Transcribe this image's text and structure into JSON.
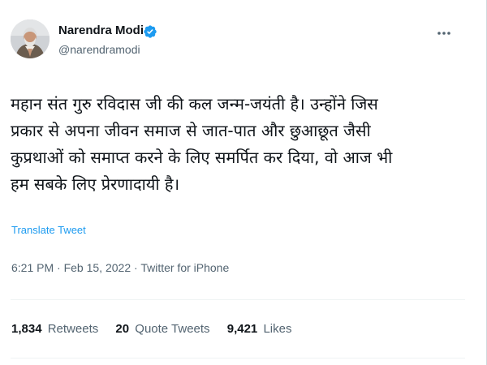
{
  "author": {
    "name": "Narendra Modi",
    "handle": "@narendramodi",
    "verified": true
  },
  "tweet": {
    "lines": [
      "महान संत गुरु रविदास जी की कल जन्म-जयंती है। उन्होंने जिस",
      "प्रकार से अपना जीवन समाज से जात-पात और छुआछूत जैसी",
      "कुप्रथाओं को समाप्त करने के लिए समर्पित कर दिया, वो आज भी",
      "हम सबके लिए प्रेरणादायी है।"
    ],
    "translate_label": "Translate Tweet"
  },
  "meta": {
    "time": "6:21 PM",
    "date": "Feb 15, 2022",
    "source": "Twitter for iPhone",
    "separator": "·"
  },
  "stats": {
    "retweets_count": "1,834",
    "retweets_label": "Retweets",
    "quotes_count": "20",
    "quotes_label": "Quote Tweets",
    "likes_count": "9,421",
    "likes_label": "Likes"
  },
  "icons": {
    "verified": "verified-badge-icon",
    "more": "more-options-icon"
  },
  "colors": {
    "text_primary": "#0f1419",
    "text_secondary": "#536471",
    "accent": "#1d9bf0"
  }
}
